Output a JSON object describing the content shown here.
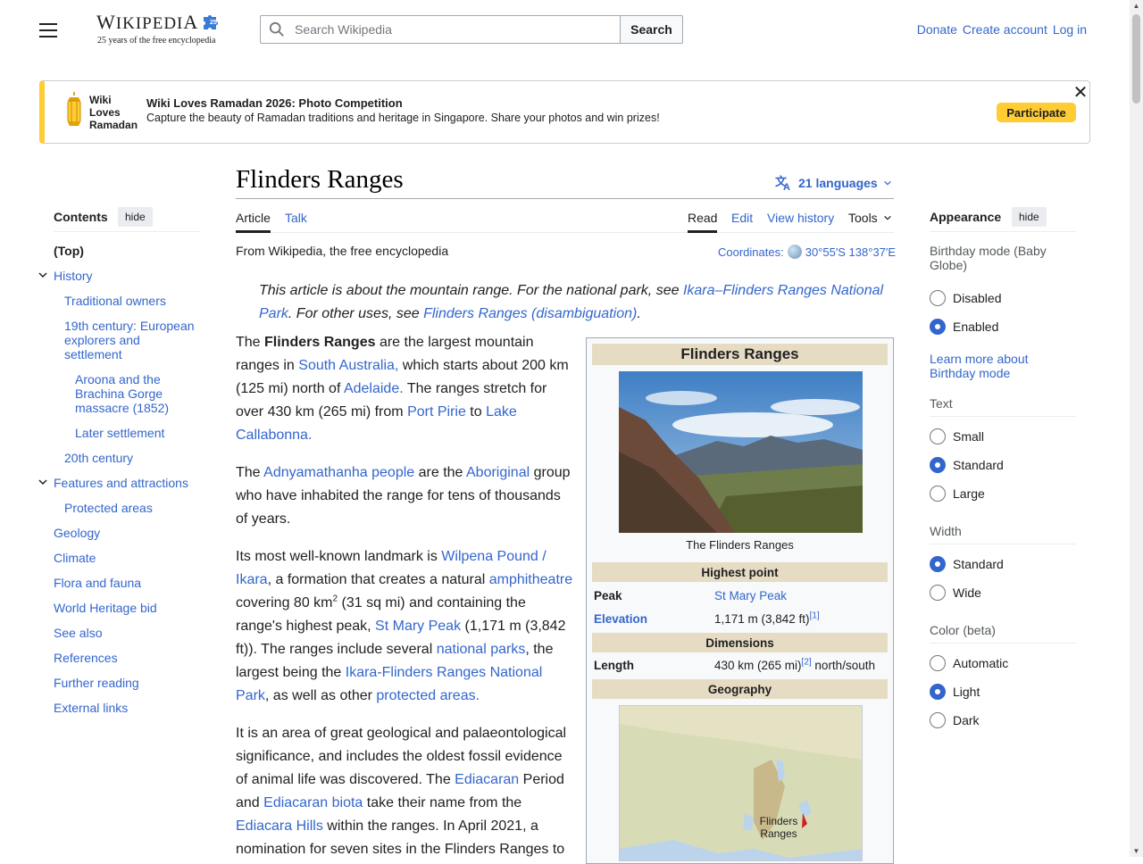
{
  "header": {
    "menu_icon": "hamburger-menu-icon",
    "logo_word": "Wikipedia",
    "logo_tagline": "25 years of the free encyclopedia",
    "search_placeholder": "Search Wikipedia",
    "search_button": "Search",
    "links": [
      "Donate",
      "Create account",
      "Log in"
    ]
  },
  "banner": {
    "brand_lines": [
      "Wiki",
      "Loves",
      "Ramadan"
    ],
    "title": "Wiki Loves Ramadan 2026: Photo Competition",
    "description": "Capture the beauty of Ramadan traditions and heritage in Singapore. Share your photos and win prizes!",
    "button": "Participate",
    "close_icon": "close-icon",
    "accent": "#ffcc33"
  },
  "toc": {
    "title": "Contents",
    "hide": "hide",
    "items": [
      {
        "label": "(Top)"
      },
      {
        "label": "History"
      },
      {
        "label": "Traditional owners"
      },
      {
        "label": "19th century: European explorers and settlement"
      },
      {
        "label": "Aroona and the Brachina Gorge massacre (1852)"
      },
      {
        "label": "Later settlement"
      },
      {
        "label": "20th century"
      },
      {
        "label": "Features and attractions"
      },
      {
        "label": "Protected areas"
      },
      {
        "label": "Geology"
      },
      {
        "label": "Climate"
      },
      {
        "label": "Flora and fauna"
      },
      {
        "label": "World Heritage bid"
      },
      {
        "label": "See also"
      },
      {
        "label": "References"
      },
      {
        "label": "Further reading"
      },
      {
        "label": "External links"
      }
    ]
  },
  "article": {
    "title": "Flinders Ranges",
    "languages": "21 languages",
    "tabs": {
      "article": "Article",
      "talk": "Talk",
      "read": "Read",
      "edit": "Edit",
      "history": "View history",
      "tools": "Tools"
    },
    "from": "From Wikipedia, the free encyclopedia",
    "coords_label": "Coordinates:",
    "coords_value": "30°55′S 138°37′E",
    "hatnote": {
      "p1": "This article is about the mountain range. For the national park, see ",
      "l1": "Ikara–Flinders Ranges National Park",
      "p2": ". For other uses, see ",
      "l2": "Flinders Ranges (disambiguation)",
      "p3": "."
    },
    "para1": {
      "t1": "The ",
      "b1": "Flinders Ranges",
      "t2": " are the largest mountain ranges in ",
      "l1": "South Australia,",
      "t3": " which starts about 200 km (125 mi) north of ",
      "l2": "Adelaide.",
      "t4": " The ranges stretch for over 430 km (265 mi) from ",
      "l3": "Port Pirie",
      "t5": " to ",
      "l4": "Lake Callabonna."
    },
    "para2": {
      "t1": "The ",
      "l1": "Adnyamathanha people",
      "t2": " are the ",
      "l2": "Aboriginal",
      "t3": " group who have inhabited the range for tens of thousands of years."
    },
    "para3": {
      "t1": "Its most well-known landmark is ",
      "l1": "Wilpena Pound / Ikara",
      "t2": ", a formation that creates a natural ",
      "l2": "amphitheatre",
      "t3": " covering 80 km",
      "sup": "2",
      "t4": " (31 sq mi) and containing the range's highest peak, ",
      "l3": "St Mary Peak",
      "t5": " (1,171 m (3,842 ft)). The ranges include several ",
      "l4": "national parks",
      "t6": ", the largest being the ",
      "l5": "Ikara-Flinders Ranges National Park",
      "t7": ", as well as other ",
      "l6": "protected areas."
    },
    "para4": {
      "t1": "It is an area of great geological and palaeontological significance, and includes the oldest fossil evidence of animal life was discovered. The ",
      "l1": "Ediacaran",
      "t2": " Period and ",
      "l2": "Ediacaran biota",
      "t3": " take their name from the ",
      "l3": "Ediacara Hills",
      "t4": " within the ranges. In April 2021, a nomination for seven sites in the Flinders Ranges to"
    }
  },
  "infobox": {
    "title": "Flinders Ranges",
    "caption": "The Flinders Ranges",
    "highest_point": "Highest point",
    "peak_label": "Peak",
    "peak_value": "St Mary Peak",
    "elevation_label": "Elevation",
    "elevation_value": "1,171 m (3,842 ft)",
    "elevation_ref": "[1]",
    "dimensions": "Dimensions",
    "length_label": "Length",
    "length_value": "430 km (265 mi)",
    "length_ref": "[2]",
    "length_suffix": " north/south",
    "geography": "Geography",
    "map_label": "Flinders Ranges"
  },
  "appearance": {
    "title": "Appearance",
    "hide": "hide",
    "birthday_label": "Birthday mode (Baby Globe)",
    "birthday_options": [
      "Disabled",
      "Enabled"
    ],
    "birthday_link": "Learn more about Birthday mode",
    "text_label": "Text",
    "text_options": [
      "Small",
      "Standard",
      "Large"
    ],
    "width_label": "Width",
    "width_options": [
      "Standard",
      "Wide"
    ],
    "color_label": "Color (beta)",
    "color_options": [
      "Automatic",
      "Light",
      "Dark"
    ],
    "selected": {
      "birthday": "Enabled",
      "text": "Standard",
      "width": "Standard",
      "color": "Light"
    }
  }
}
